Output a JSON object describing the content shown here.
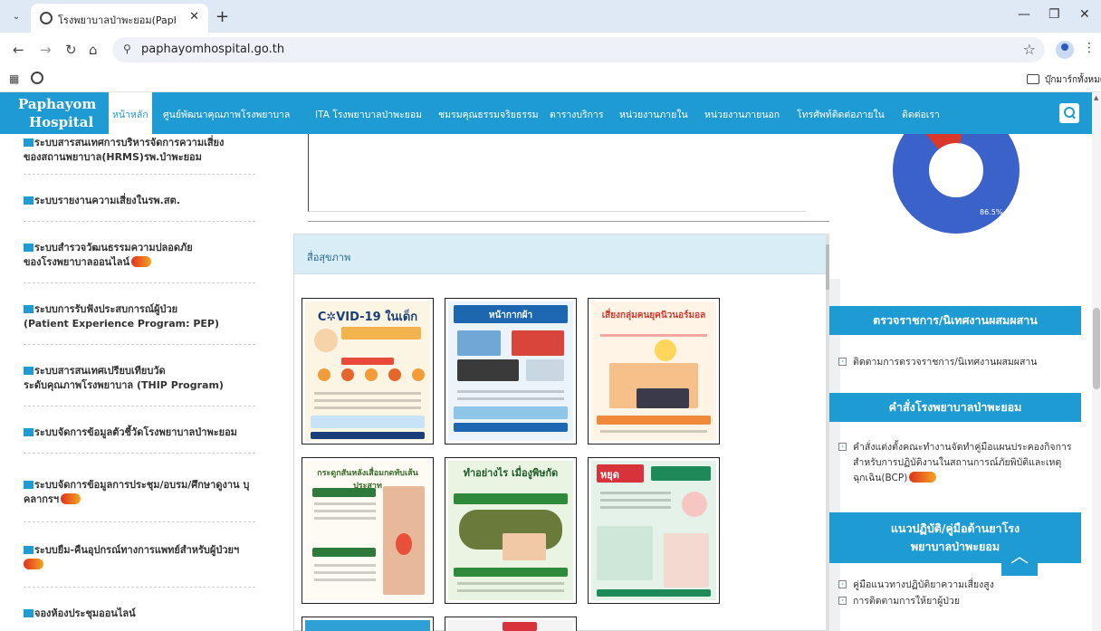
{
  "browser": {
    "tab_title": "โรงพยาบาลป่าพะยอม(Paphayomho",
    "url": "paphayomhospital.go.th",
    "bookmarks_folder": "บุ๊กมาร์กทั้งหมด",
    "tab_menu_icon": "chevron-down-icon",
    "close_icon": "close-icon",
    "new_tab_icon": "plus-icon"
  },
  "site": {
    "logo_line1": "Paphayom",
    "logo_line2": "Hospital",
    "accent_color": "#1f9bd3",
    "nav": [
      {
        "label": "หน้าหลัก",
        "active": true
      },
      {
        "label": "ศูนย์พัฒนาคุณภาพโรงพยาบาล"
      },
      {
        "label": "ITA โรงพยาบาลป่าพะยอม"
      },
      {
        "label": "ชมรมคุณธรรมจริยธรรม"
      },
      {
        "label": "ตารางบริการ"
      },
      {
        "label": "หน่วยงานภายใน"
      },
      {
        "label": "หน่วยงานภายนอก"
      },
      {
        "label": "โทรศัพท์ติดต่อภายใน"
      },
      {
        "label": "ติดต่อเรา"
      }
    ]
  },
  "sidebar": {
    "items": [
      {
        "line1": "ระบบสารสนเทศการบริหารจัดการความเสี่ยง",
        "line2": "ของสถานพยาบาล(HRMS)รพ.ป่าพะยอม",
        "new": false
      },
      {
        "line1": "ระบบรายงานความเสี่ยงในรพ.สต.",
        "line2": "",
        "new": false
      },
      {
        "line1": "ระบบสำรวจวัฒนธรรมความปลอดภัย",
        "line2": "ของโรงพยาบาลออนไลน์",
        "new": true
      },
      {
        "line1": "ระบบการรับฟังประสบการณ์ผู้ป่วย",
        "line2": "(Patient Experience Program: PEP)",
        "new": false
      },
      {
        "line1": "ระบบสารสนเทศเปรียบเทียบวัด",
        "line2": "ระดับคุณภาพโรงพยาบาล (THIP Program)",
        "new": false
      },
      {
        "line1": "ระบบจัดการข้อมูลตัวชี้วัดโรงพยาบาลป่าพะยอม",
        "line2": "",
        "new": false
      },
      {
        "line1": "ระบบจัดการข้อมูลการประชุม/อบรม/ศึกษาดูงาน บุ",
        "line2": "คลากรฯ",
        "new": true
      },
      {
        "line1": "ระบบยืม-คืนอุปกรณ์ทางการแพทย์สำหรับผู้ป่วยฯ",
        "line2": "",
        "new": true
      },
      {
        "line1": "จองห้องประชุมออนไลน์",
        "line2": "",
        "new": false
      }
    ]
  },
  "main": {
    "panel_title": "สื่อสุขภาพ",
    "posters": [
      {
        "title": "C✲VID-19 ในเด็ก",
        "theme": "covid-kids"
      },
      {
        "title": "หน้ากากผ้า",
        "theme": "cloth-mask"
      },
      {
        "title": "เสี่ยงกลุ่มคนยุคนิวนอร์มอล",
        "theme": "new-normal"
      },
      {
        "title": "กระดูกสันหลังเสื่อมกดทับเส้นประสาท",
        "theme": "spine"
      },
      {
        "title": "ทำอย่างไร เมื่องูพิษกัด",
        "theme": "snake"
      },
      {
        "title": "หยุด",
        "theme": "stop"
      }
    ]
  },
  "right": {
    "donut_label": "86.5%",
    "donut_percent": 86.5,
    "sections": [
      {
        "header": "ตรวจราชการ/นิเทศงานผสมผสาน",
        "links": [
          "ติดตามการตรวจราชการ/นิเทศงานผสมผสาน"
        ]
      },
      {
        "header": "คำสั่งโรงพยาบาลป่าพะยอม",
        "links": [
          "คำสั่งแต่งตั้งคณะทำงานจัดทำคู่มือแผนประคองกิจการสำหรับการปฏิบัติงานในสถานการณ์ภัยพิบัติและเหตุฉุกเฉิน(BCP)"
        ]
      },
      {
        "header": "แนวปฏิบัติ/คู่มือด้านยาโรงพยาบาลป่าพะยอม",
        "links": [
          "คู่มือแนวทางปฏิบัติยาความเสี่ยงสูง",
          "การติดตามการให้ยาผู้ป่วย"
        ]
      }
    ]
  }
}
